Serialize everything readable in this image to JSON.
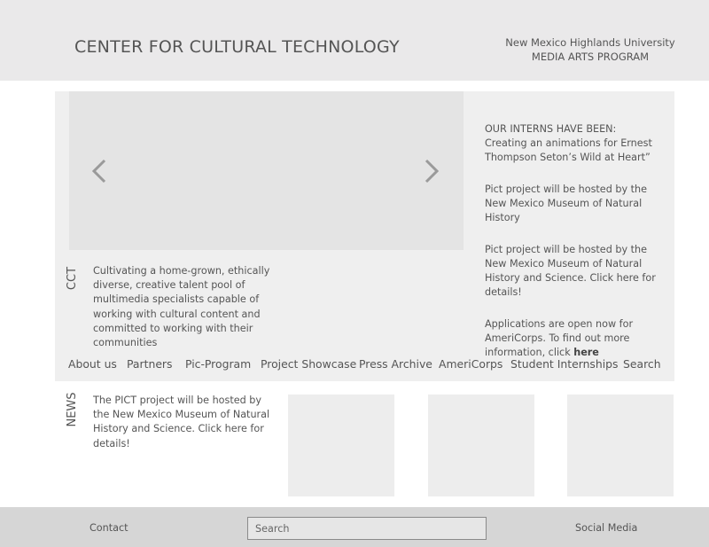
{
  "header": {
    "title": "CENTER FOR CULTURAL TECHNOLOGY",
    "university": "New Mexico Highlands University",
    "program": "MEDIA ARTS PROGRAM"
  },
  "slider": {
    "prev_icon": "chevron-left-icon",
    "next_icon": "chevron-right-icon"
  },
  "interns": {
    "heading": "OUR INTERNS HAVE BEEN:",
    "item1": "Creating an animations for Ernest Thompson Seton’s Wild at Heart”",
    "item2": "Pict project will be hosted by the New Mexico Museum of Natural History",
    "item3": "Pict project will be hosted by the New Mexico Museum of Natural History and Science. Click here for details!",
    "item4_prefix": "Applications are open now for AmeriCorps. To find out more information, click ",
    "item4_link": "here"
  },
  "cct": {
    "label": "CCT",
    "mission": "Cultivating a home-grown, ethically diverse, creative talent pool of multimedia specialists capable of working with cultural content and committed to working with their communities"
  },
  "nav": {
    "items": [
      "About us",
      "Partners",
      "Pic-Program",
      "Project Showcase",
      "Press Archive",
      "AmeriCorps",
      "Student Internships",
      "Search"
    ]
  },
  "news": {
    "label": "NEWS",
    "text": "The PICT project will be hosted by the New Mexico Museum of Natural History and Science. Click here for details!"
  },
  "footer": {
    "contact": "Contact",
    "search_placeholder": "Search",
    "social": "Social Media"
  },
  "colors": {
    "header_bg": "#eae9ea",
    "panel_bg": "#efefef",
    "slider_bg": "#e4e4e4",
    "footer_bg": "#d6d6d6",
    "text": "#555555"
  }
}
